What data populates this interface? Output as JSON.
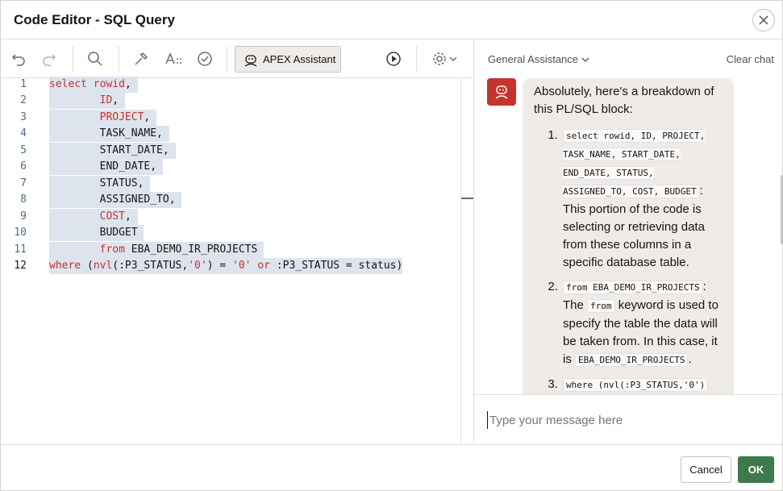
{
  "dialog": {
    "title": "Code Editor - SQL Query"
  },
  "toolbar": {
    "undo_icon": "undo-icon",
    "redo_icon": "redo-icon",
    "search_icon": "search-icon",
    "format_icon": "hammer-icon",
    "autocomplete_icon": "text-case-icon",
    "validate_icon": "check-circle-icon",
    "assistant_label": "APEX Assistant",
    "run_icon": "play-icon",
    "settings_icon": "gear-icon"
  },
  "editor": {
    "line_numbers": [
      "1",
      "2",
      "3",
      "4",
      "5",
      "6",
      "7",
      "8",
      "9",
      "10",
      "11",
      "12"
    ],
    "lines": [
      "select rowid,",
      "ID,",
      "PROJECT,",
      "TASK_NAME,",
      "START_DATE,",
      "END_DATE,",
      "STATUS,",
      "ASSIGNED_TO,",
      "COST,",
      "BUDGET",
      "from EBA_DEMO_IR_PROJECTS",
      "where (nvl(:P3_STATUS,'0') = '0' or :P3_STATUS = status)"
    ]
  },
  "assistant": {
    "mode": "General Assistance",
    "clear_chat": "Clear chat",
    "intro": "Absolutely, here's a breakdown of this PL/SQL block:",
    "item1_code": "select rowid, ID, PROJECT, TASK_NAME, START_DATE, END_DATE, STATUS, ASSIGNED_TO, COST, BUDGET",
    "item1_text": "This portion of the code is selecting or retrieving data from these columns in a specific database table.",
    "item2_code": "from EBA_DEMO_IR_PROJECTS",
    "item2_text_a": "The",
    "item2_kw": "from",
    "item2_text_b": "keyword is used to specify the table the data will be taken from. In this case, it is",
    "item2_table": "EBA_DEMO_IR_PROJECTS",
    "item3_code": "where (nvl(:P3_STATUS,'0')",
    "input_placeholder": "Type your message here"
  },
  "footer": {
    "cancel": "Cancel",
    "ok": "OK"
  }
}
